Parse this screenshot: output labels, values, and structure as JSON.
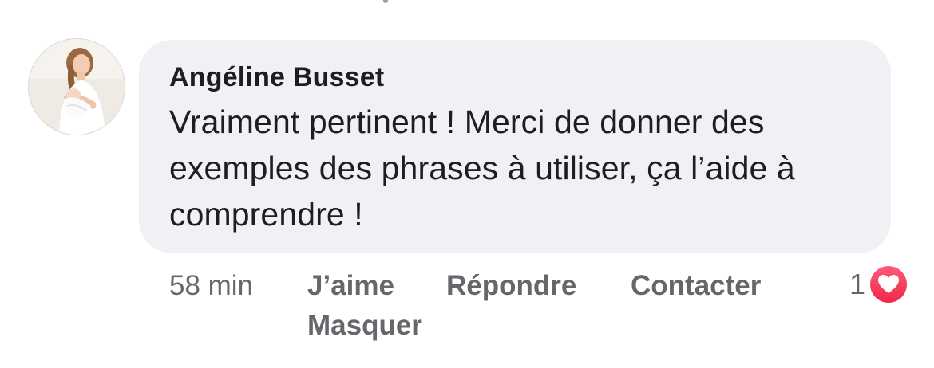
{
  "comment": {
    "author": "Angéline Busset",
    "text": "Vraiment pertinent ! Merci de donner des exemples des phrases à utiliser, ça l’aide à comprendre !",
    "avatar_icon": "user-photo-avatar"
  },
  "actions": {
    "time": "58 min",
    "like_label": "J’aime",
    "reply_label": "Répondre",
    "contact_label": "Contacter",
    "hide_label": "Masquer"
  },
  "reactions": {
    "count": "1",
    "icon": "heart-icon",
    "color": "#f02849"
  },
  "colors": {
    "bubble": "#f0f1f5",
    "text": "#1c1e21",
    "muted": "#65676b"
  }
}
